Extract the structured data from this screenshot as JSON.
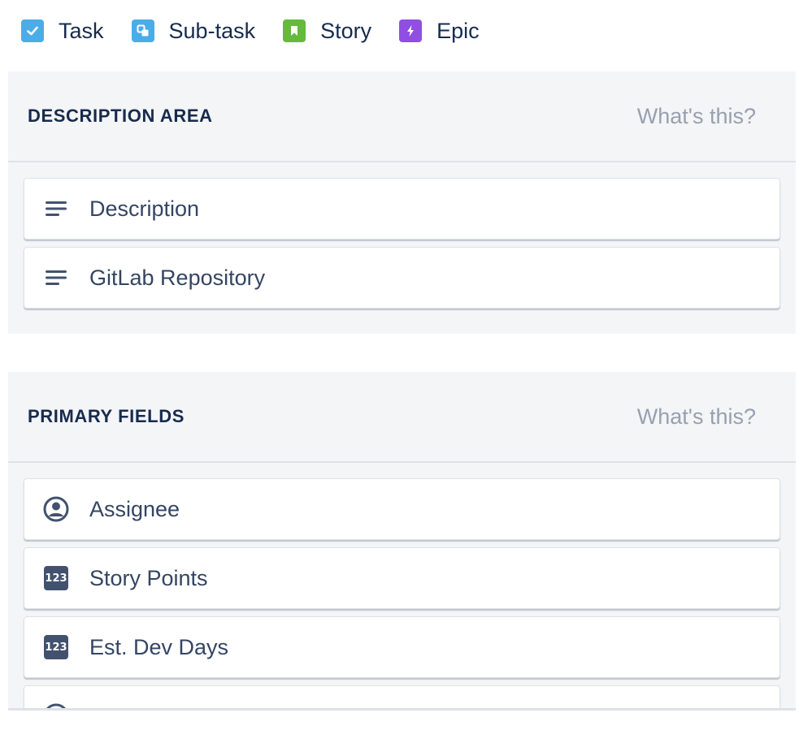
{
  "issue_types": [
    {
      "label": "Task",
      "icon": "task-checkbox-icon",
      "color": "#4bade8"
    },
    {
      "label": "Sub-task",
      "icon": "subtask-icon",
      "color": "#4bade8"
    },
    {
      "label": "Story",
      "icon": "story-bookmark-icon",
      "color": "#63ba3c"
    },
    {
      "label": "Epic",
      "icon": "epic-lightning-icon",
      "color": "#904ee2"
    }
  ],
  "description_area": {
    "title": "DESCRIPTION AREA",
    "help": "What's this?",
    "fields": [
      {
        "label": "Description",
        "icon": "paragraph-icon"
      },
      {
        "label": "GitLab Repository",
        "icon": "paragraph-icon"
      }
    ]
  },
  "primary_fields": {
    "title": "PRIMARY FIELDS",
    "help": "What's this?",
    "fields": [
      {
        "label": "Assignee",
        "icon": "user-avatar-icon"
      },
      {
        "label": "Story Points",
        "icon": "number-icon",
        "badge": "123"
      },
      {
        "label": "Est. Dev Days",
        "icon": "number-icon",
        "badge": "123"
      },
      {
        "label": "",
        "icon": "user-avatar-icon"
      }
    ]
  }
}
